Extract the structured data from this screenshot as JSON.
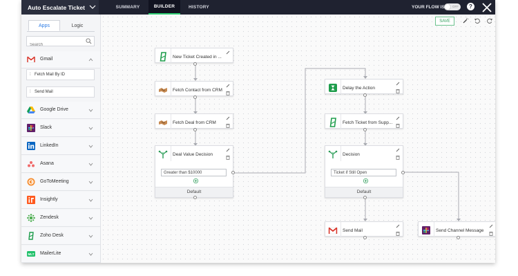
{
  "header": {
    "flow_name": "Auto Escalate Ticket",
    "tabs": [
      {
        "label": "SUMMARY"
      },
      {
        "label": "BUILDER"
      },
      {
        "label": "HISTORY"
      }
    ],
    "flow_status_label": "YOUR FLOW IS",
    "flow_toggle_text": "OFF",
    "help_label": "?"
  },
  "sidebar": {
    "tabs": [
      {
        "label": "Apps"
      },
      {
        "label": "Logic"
      }
    ],
    "search_placeholder": "Search",
    "apps": [
      {
        "label": "Gmail",
        "icon": "gmail-icon"
      },
      {
        "label": "Google Drive",
        "icon": "google-drive-icon"
      },
      {
        "label": "Slack",
        "icon": "slack-icon"
      },
      {
        "label": "LinkedIn",
        "icon": "linkedin-icon"
      },
      {
        "label": "Asana",
        "icon": "asana-icon"
      },
      {
        "label": "GoToMeeting",
        "icon": "gotomeeting-icon"
      },
      {
        "label": "Insightly",
        "icon": "insightly-icon"
      },
      {
        "label": "Zendesk",
        "icon": "zendesk-icon"
      },
      {
        "label": "Zoho Desk",
        "icon": "zoho-desk-icon"
      },
      {
        "label": "MailerLite",
        "icon": "mailerlite-icon"
      }
    ],
    "gmail_actions": [
      {
        "label": "Fetch Mail By ID"
      },
      {
        "label": "Send Mail"
      }
    ]
  },
  "toolbar": {
    "save_label": "SAVE",
    "tools": [
      "magic-wand-icon",
      "undo-icon",
      "redo-icon",
      "play-icon"
    ]
  },
  "nodes": {
    "trigger": {
      "title": "New Ticket Created in ..."
    },
    "fetch_contact": {
      "title": "Fetch Contact from CRM"
    },
    "fetch_deal": {
      "title": "Fetch Deal from CRM"
    },
    "deal_decision": {
      "title": "Deal Value Decision",
      "condition": "Greater than $10000",
      "default_label": "Default"
    },
    "delay": {
      "title": "Delay the Action"
    },
    "fetch_ticket": {
      "title": "Fetch Ticket from Supp..."
    },
    "decision": {
      "title": "Decision",
      "condition": "Ticket if Still Open",
      "default_label": "Default"
    },
    "send_mail": {
      "title": "Send Mail"
    },
    "send_channel": {
      "title": "Send Channel Message"
    }
  },
  "colors": {
    "topbar": "#1f2230",
    "active_tab_underline": "#2ecc71",
    "save_border": "#6cc28e",
    "zoho_green": "#1f9d4c"
  }
}
